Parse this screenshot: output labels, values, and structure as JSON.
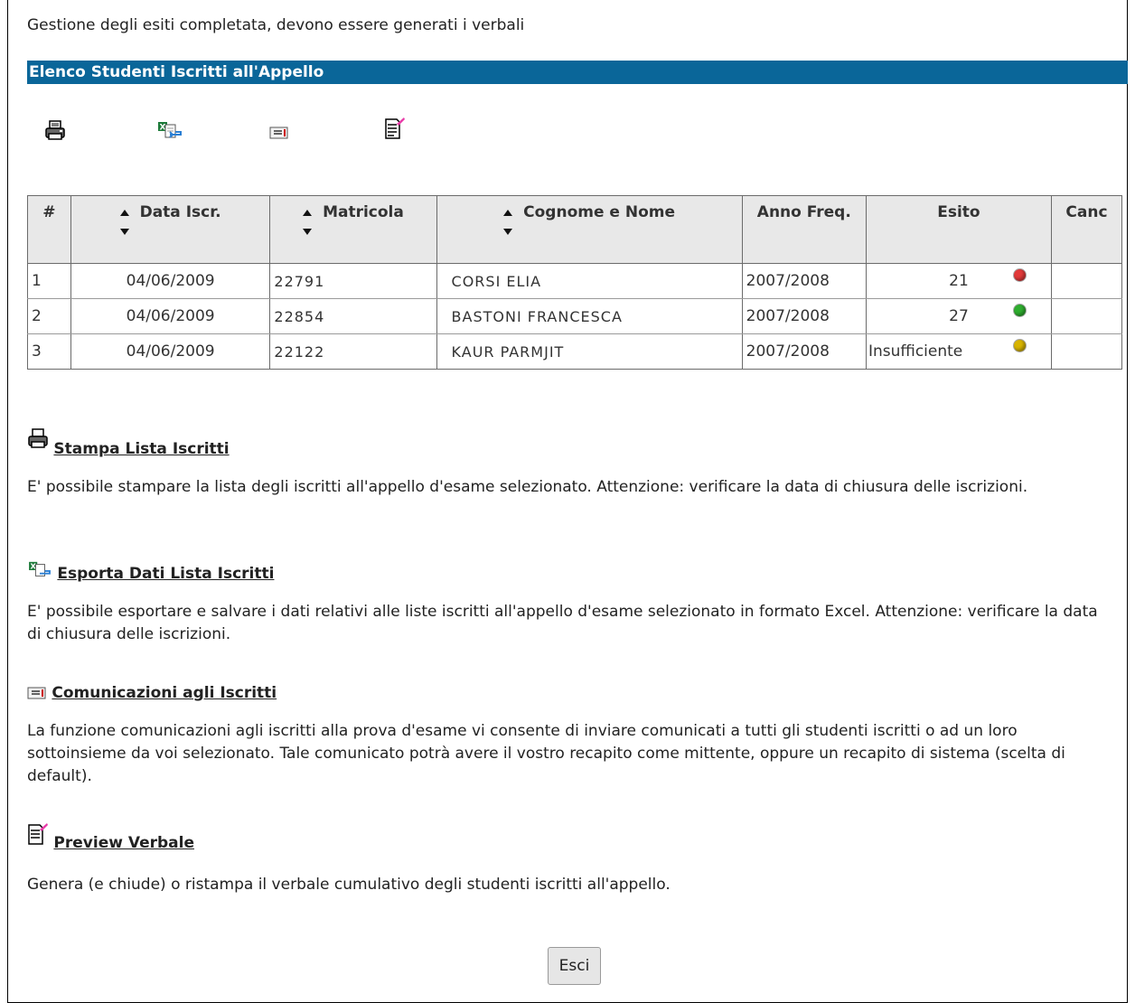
{
  "status_message": "Gestione degli esiti completata, devono essere generati i verbali",
  "section_title": "Elenco Studenti Iscritti all'Appello",
  "table": {
    "headers": {
      "num": "#",
      "data_iscr": "Data Iscr.",
      "matricola": "Matricola",
      "cognome_nome": "Cognome e Nome",
      "anno_freq": "Anno Freq.",
      "esito": "Esito",
      "canc": "Canc"
    },
    "rows": [
      {
        "num": "1",
        "data_iscr": "04/06/2009",
        "matricola": "22791",
        "cognome_nome": "CORSI ELIA",
        "anno_freq": "2007/2008",
        "esito": "21",
        "esito_color": "#e23a3a"
      },
      {
        "num": "2",
        "data_iscr": "04/06/2009",
        "matricola": "22854",
        "cognome_nome": "BASTONI FRANCESCA",
        "anno_freq": "2007/2008",
        "esito": "27",
        "esito_color": "#2fae2f"
      },
      {
        "num": "3",
        "data_iscr": "04/06/2009",
        "matricola": "22122",
        "cognome_nome": "KAUR PARMJIT",
        "anno_freq": "2007/2008",
        "esito": "Insufficiente",
        "esito_color": "#d8b400"
      }
    ]
  },
  "help": {
    "stampa": {
      "title": "Stampa Lista Iscritti",
      "text": "E' possibile stampare la lista degli iscritti all'appello d'esame selezionato. Attenzione: verificare la data di chiusura delle iscrizioni."
    },
    "esporta": {
      "title": "Esporta Dati Lista Iscritti",
      "text": "E' possibile esportare e salvare i dati relativi alle liste iscritti all'appello d'esame selezionato in formato Excel. Attenzione: verificare la data di chiusura delle iscrizioni."
    },
    "comunicazioni": {
      "title": "Comunicazioni agli Iscritti",
      "text": "La funzione comunicazioni agli iscritti alla prova d'esame vi consente di inviare comunicati a tutti gli studenti iscritti o ad un loro sottoinsieme da voi selezionato. Tale comunicato potrà avere il vostro recapito come mittente, oppure un recapito di sistema (scelta di default)."
    },
    "preview": {
      "title": "Preview Verbale",
      "text": "Genera (e chiude) o ristampa il verbale cumulativo degli studenti iscritti all'appello."
    }
  },
  "buttons": {
    "esci": "Esci"
  },
  "colors": {
    "section_bar": "#0a6699",
    "header_bg": "#e8e8e8"
  },
  "icons": [
    "printer-icon",
    "excel-export-icon",
    "message-icon",
    "edit-document-icon"
  ]
}
